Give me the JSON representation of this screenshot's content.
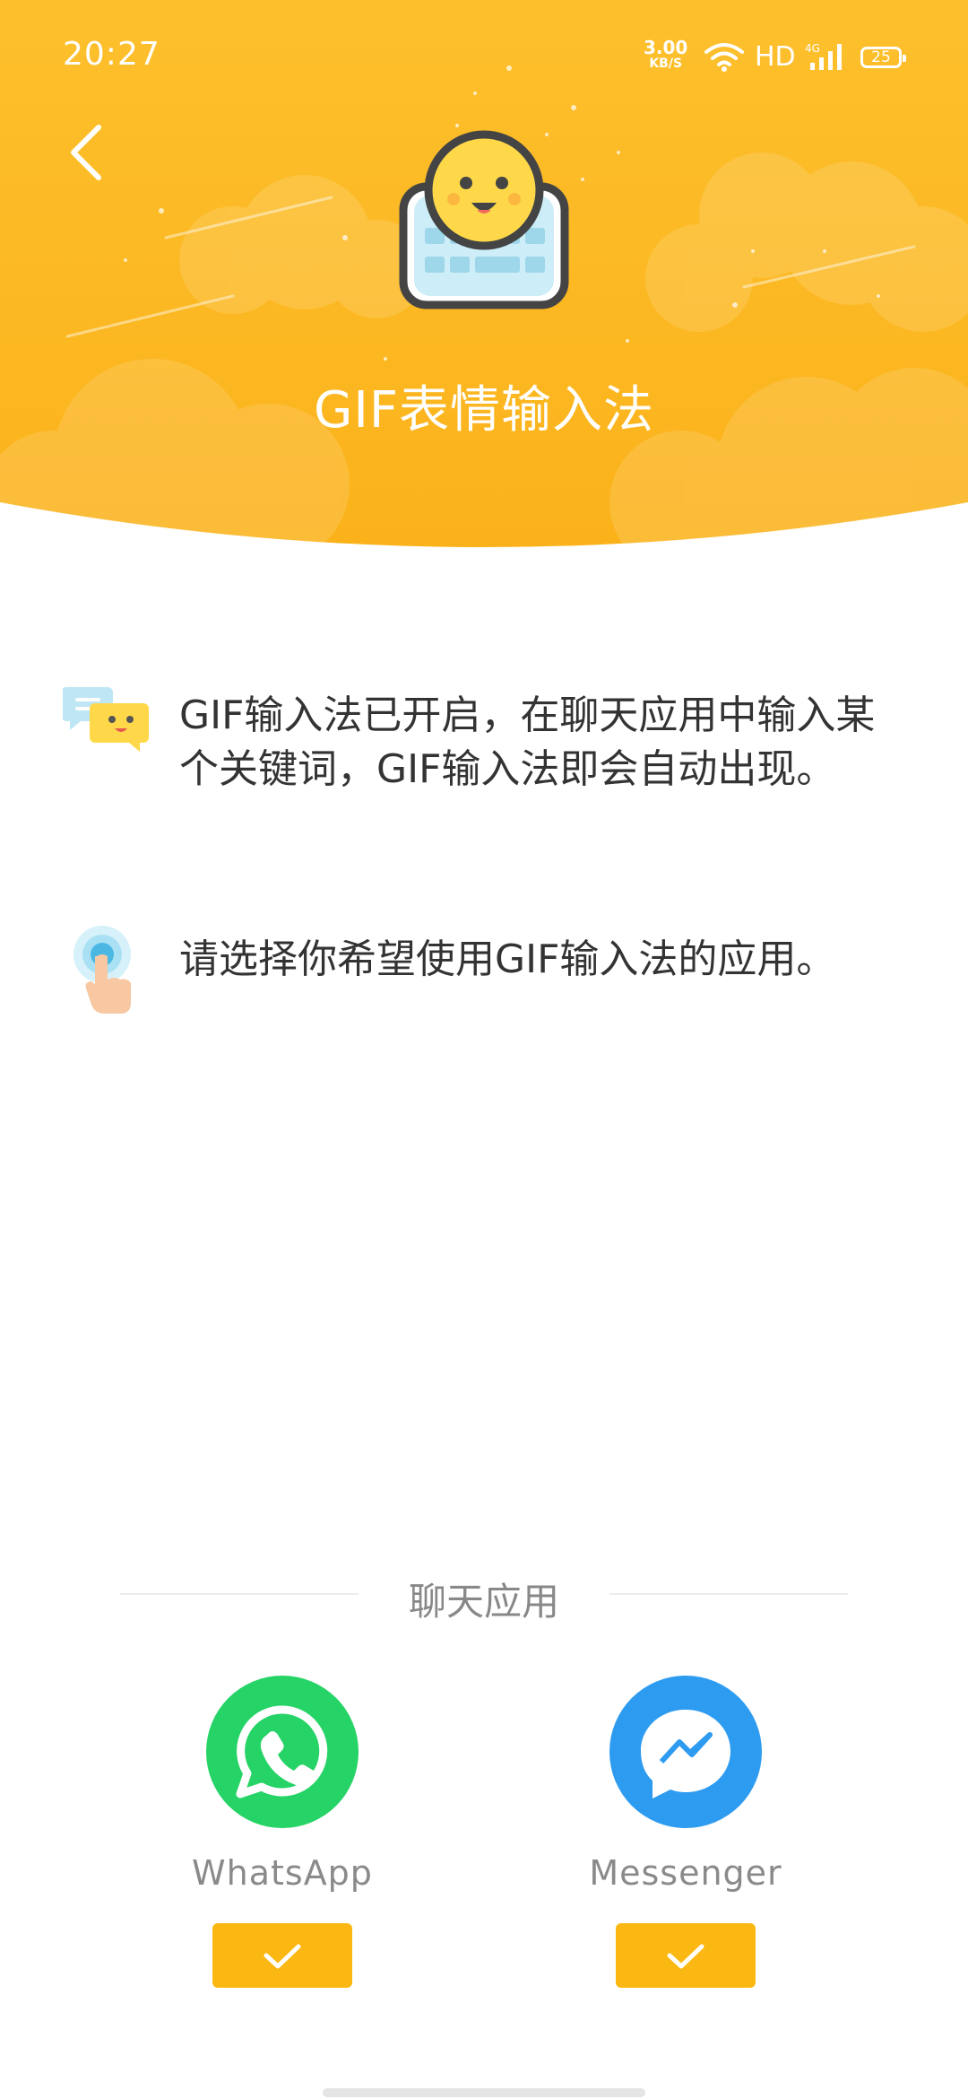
{
  "status_bar": {
    "time": "20:27",
    "net_speed_value": "3.00",
    "net_speed_unit": "KB/S",
    "hd_label": "HD",
    "network_type": "4G",
    "battery_level": "25"
  },
  "header": {
    "title": "GIF表情输入法",
    "back_icon": "chevron-left-icon",
    "hero_icon": "emoji-keyboard-icon",
    "colors": {
      "gradient_top": "#FDC02D",
      "gradient_bottom": "#FBB21A"
    }
  },
  "info": [
    {
      "icon": "chat-bubbles-icon",
      "text": "GIF输入法已开启，在聊天应用中输入某个关键词，GIF输入法即会自动出现。"
    },
    {
      "icon": "tap-hand-icon",
      "text": "请选择你希望使用GIF输入法的应用。"
    }
  ],
  "chat_apps": {
    "section_title": "聊天应用",
    "apps": [
      {
        "name": "WhatsApp",
        "icon": "whatsapp-icon",
        "color": "#25D366",
        "checked": true
      },
      {
        "name": "Messenger",
        "icon": "messenger-icon",
        "color": "#2D9BF0",
        "checked": true
      }
    ],
    "check_color": "#FBB812"
  }
}
